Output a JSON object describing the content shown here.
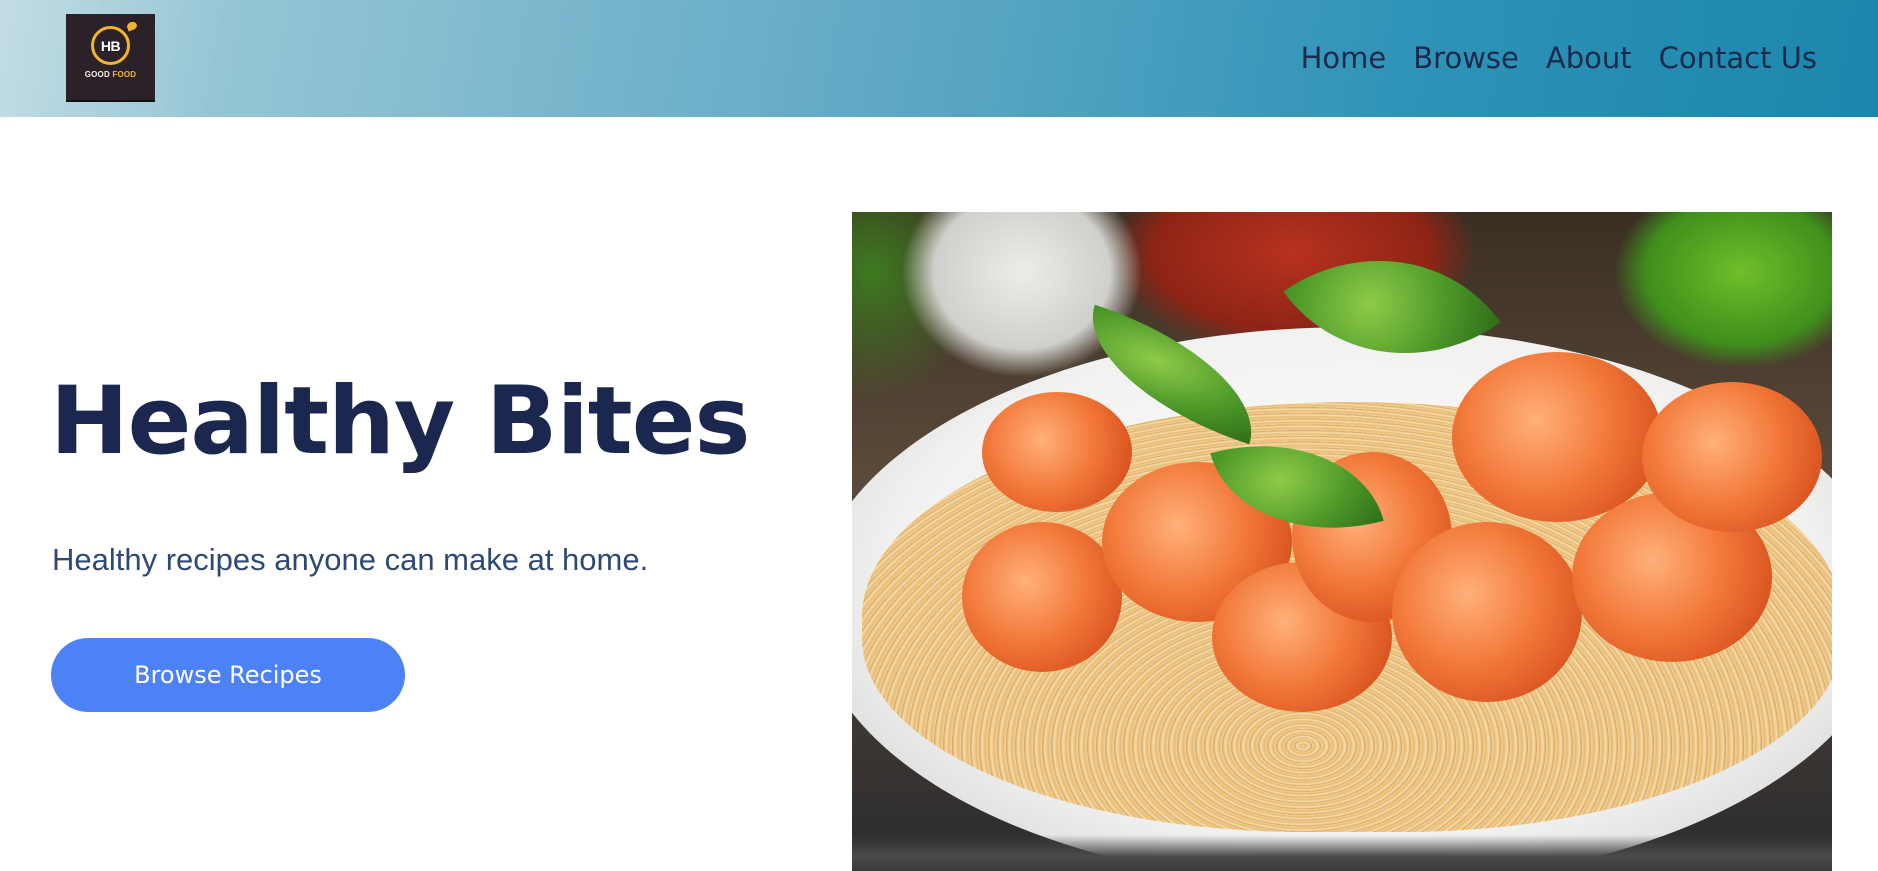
{
  "header": {
    "logo": {
      "initials": "HB",
      "tagline_part1": "GOOD",
      "tagline_part2": "FOOD"
    },
    "nav": [
      {
        "label": "Home"
      },
      {
        "label": "Browse"
      },
      {
        "label": "About"
      },
      {
        "label": "Contact Us"
      }
    ]
  },
  "hero": {
    "title": "Healthy Bites",
    "subtitle": "Healthy recipes anyone can make at home.",
    "cta_label": "Browse Recipes",
    "cta_color": "#4d82f7"
  },
  "colors": {
    "title": "#1c2750",
    "nav_text": "#1e2a4c",
    "header_gradient_start": "#c3dde4",
    "header_gradient_end": "#1b86ad"
  }
}
